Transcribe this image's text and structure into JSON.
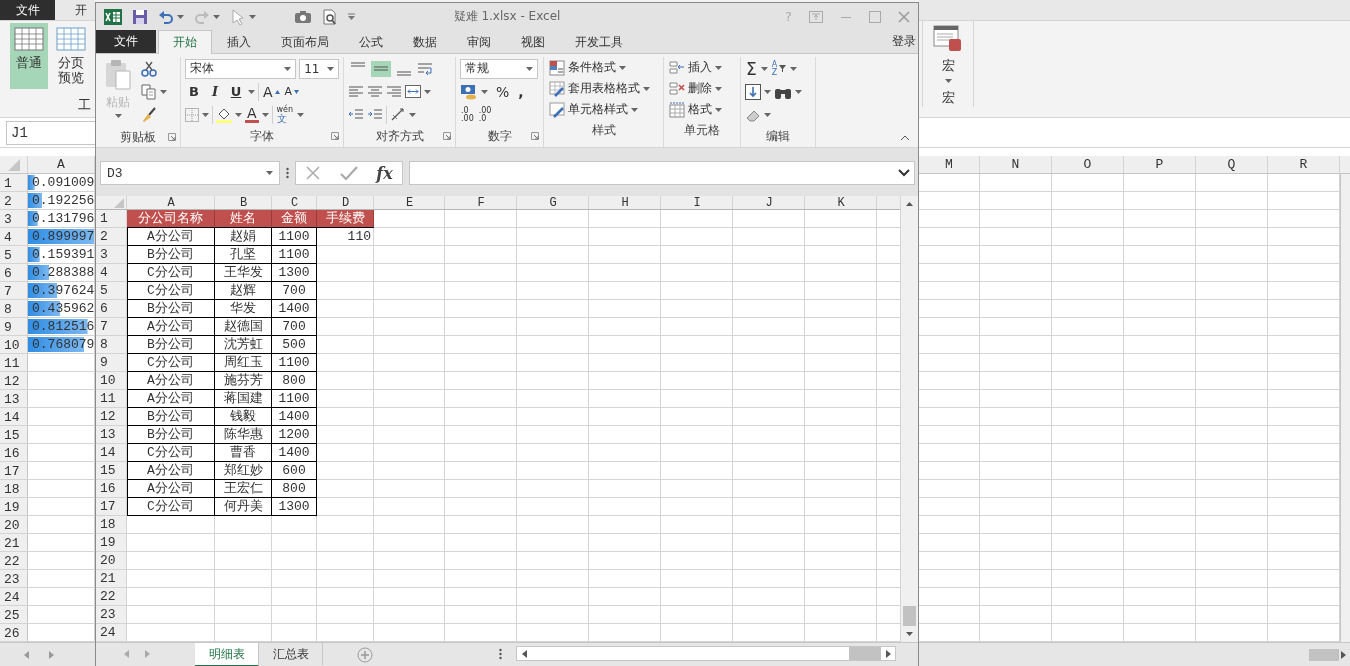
{
  "back_window": {
    "tabs": [
      {
        "label": "文件",
        "kind": "file"
      },
      {
        "label": "开",
        "kind": "tab"
      }
    ],
    "view_buttons": [
      {
        "label": "普通",
        "selected": true
      },
      {
        "label": "分页预览",
        "selected": false
      }
    ],
    "view_group_label": "工",
    "macro_button": "宏",
    "macro_group_label": "宏",
    "name_box": "J1",
    "left_column": "A",
    "right_columns": [
      "M",
      "N",
      "O",
      "P",
      "Q",
      "R"
    ],
    "row_numbers": [
      "1",
      "2",
      "3",
      "4",
      "5",
      "6",
      "7",
      "8",
      "9",
      "10",
      "11",
      "12",
      "13",
      "14",
      "15",
      "16",
      "17",
      "18",
      "19",
      "20",
      "21",
      "22",
      "23",
      "24",
      "25",
      "26"
    ],
    "values": [
      {
        "text": "0.091009"
      },
      {
        "text": "0.192256"
      },
      {
        "text": "0.131796"
      },
      {
        "text": "0.899997"
      },
      {
        "text": "0.159391"
      },
      {
        "text": "0.288388"
      },
      {
        "text": "0.397624"
      },
      {
        "text": "0.435962"
      },
      {
        "text": "0.812516"
      },
      {
        "text": "0.768079"
      }
    ]
  },
  "window": {
    "title": "疑难 1.xlsx - Excel",
    "help": "?",
    "tabs": [
      {
        "label": "文件",
        "kind": "file",
        "selected": false
      },
      {
        "label": "开始",
        "kind": "tab",
        "selected": true
      },
      {
        "label": "插入",
        "kind": "tab",
        "selected": false
      },
      {
        "label": "页面布局",
        "kind": "tab",
        "selected": false
      },
      {
        "label": "公式",
        "kind": "tab",
        "selected": false
      },
      {
        "label": "数据",
        "kind": "tab",
        "selected": false
      },
      {
        "label": "审阅",
        "kind": "tab",
        "selected": false
      },
      {
        "label": "视图",
        "kind": "tab",
        "selected": false
      },
      {
        "label": "开发工具",
        "kind": "tab",
        "selected": false
      }
    ],
    "sign_in": "登录",
    "clipboard": {
      "paste": "粘贴",
      "paste_disabled": true,
      "group_label": "剪贴板"
    },
    "font": {
      "name": "宋体",
      "size": "11",
      "bold": "B",
      "italic": "I",
      "underline": "U",
      "grow": "A",
      "shrink": "A",
      "color_letter": "A",
      "phonetic": "wén",
      "phonetic_char": "文",
      "group_label": "字体"
    },
    "alignment": {
      "vertical": [
        {
          "selected": false
        },
        {
          "selected": true
        },
        {
          "selected": false
        }
      ],
      "group_label": "对齐方式"
    },
    "number": {
      "format": "常规",
      "percent": "%",
      "comma": ",",
      "increase_decimal": [
        ".0",
        ".00"
      ],
      "decrease_decimal": [
        ".00",
        ".0"
      ],
      "group_label": "数字"
    },
    "styles": {
      "buttons": [
        "条件格式",
        "套用表格格式",
        "单元格样式"
      ],
      "group_label": "样式"
    },
    "cells": {
      "buttons": [
        "插入",
        "删除",
        "格式"
      ],
      "group_label": "单元格"
    },
    "editing": {
      "sum": "Σ",
      "sort": [
        "A",
        "Z"
      ],
      "group_label": "编辑"
    },
    "name_box": "D3",
    "function_label": "fx",
    "columns": [
      "A",
      "B",
      "C",
      "D",
      "E",
      "F",
      "G",
      "H",
      "I",
      "J",
      "K"
    ],
    "rows": [
      {
        "number": "1",
        "kind": "header",
        "cells": [
          "分公司名称",
          "姓名",
          "金额",
          "手续费"
        ]
      },
      {
        "number": "2",
        "kind": "data",
        "cells": [
          "A分公司",
          "赵娟",
          "1100",
          "110"
        ]
      },
      {
        "number": "3",
        "kind": "data",
        "cells": [
          "B分公司",
          "孔坚",
          "1100"
        ]
      },
      {
        "number": "4",
        "kind": "data",
        "cells": [
          "C分公司",
          "王华发",
          "1300"
        ]
      },
      {
        "number": "5",
        "kind": "data",
        "cells": [
          "C分公司",
          "赵辉",
          "700"
        ]
      },
      {
        "number": "6",
        "kind": "data",
        "cells": [
          "B分公司",
          "华发",
          "1400"
        ]
      },
      {
        "number": "7",
        "kind": "data",
        "cells": [
          "A分公司",
          "赵德国",
          "700"
        ]
      },
      {
        "number": "8",
        "kind": "data",
        "cells": [
          "B分公司",
          "沈芳虹",
          "500"
        ]
      },
      {
        "number": "9",
        "kind": "data",
        "cells": [
          "C分公司",
          "周红玉",
          "1100"
        ]
      },
      {
        "number": "10",
        "kind": "data",
        "cells": [
          "A分公司",
          "施芬芳",
          "800"
        ]
      },
      {
        "number": "11",
        "kind": "data",
        "cells": [
          "A分公司",
          "蒋国建",
          "1100"
        ]
      },
      {
        "number": "12",
        "kind": "data",
        "cells": [
          "B分公司",
          "钱毅",
          "1400"
        ]
      },
      {
        "number": "13",
        "kind": "data",
        "cells": [
          "B分公司",
          "陈华惠",
          "1200"
        ]
      },
      {
        "number": "14",
        "kind": "data",
        "cells": [
          "C分公司",
          "曹香",
          "1400"
        ]
      },
      {
        "number": "15",
        "kind": "data",
        "cells": [
          "A分公司",
          "郑红妙",
          "600"
        ]
      },
      {
        "number": "16",
        "kind": "data",
        "cells": [
          "A分公司",
          "王宏仁",
          "800"
        ]
      },
      {
        "number": "17",
        "kind": "data",
        "cells": [
          "C分公司",
          "何丹美",
          "1300"
        ]
      }
    ],
    "blank_rows": [
      "18",
      "19",
      "20",
      "21",
      "22",
      "23",
      "24"
    ],
    "sheets": [
      {
        "label": "明细表",
        "selected": true
      },
      {
        "label": "汇总表",
        "selected": false
      }
    ]
  }
}
